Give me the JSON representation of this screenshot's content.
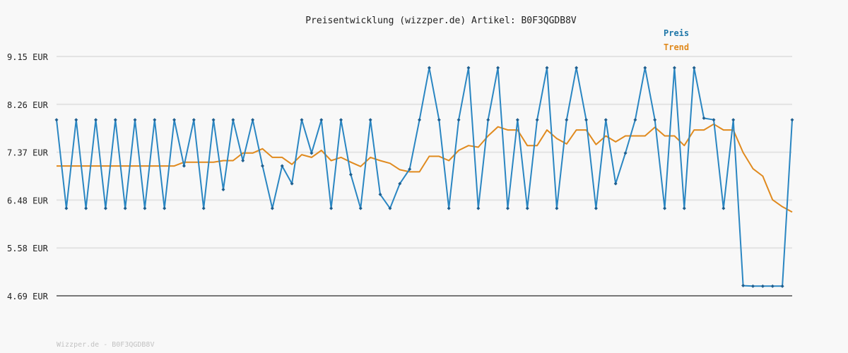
{
  "chart_data": {
    "type": "line",
    "title": "Preisentwicklung (wizzper.de) Artikel: B0F3QGDB8V",
    "footer": "Wizzper.de - B0F3QGDB8V",
    "yticks": [
      "9.15 EUR",
      "8.26 EUR",
      "7.37 EUR",
      "6.48 EUR",
      "5.58 EUR",
      "4.69 EUR"
    ],
    "ylim": [
      4.69,
      9.15
    ],
    "grid": true,
    "legend_position": "top-right",
    "series": [
      {
        "name": "Preis",
        "color": "#2a86c2",
        "markers": true,
        "values": [
          7.97,
          6.32,
          7.97,
          6.32,
          7.97,
          6.32,
          7.97,
          6.32,
          7.97,
          6.32,
          7.97,
          6.32,
          7.97,
          7.11,
          7.97,
          6.32,
          7.97,
          6.67,
          7.97,
          7.21,
          7.97,
          7.11,
          6.32,
          7.11,
          6.78,
          7.97,
          7.35,
          7.97,
          6.32,
          7.97,
          6.95,
          6.32,
          7.97,
          6.58,
          6.32,
          6.78,
          7.05,
          7.97,
          8.94,
          7.97,
          6.32,
          7.97,
          8.94,
          6.32,
          7.97,
          8.94,
          6.32,
          7.97,
          6.32,
          7.97,
          8.94,
          6.32,
          7.97,
          8.94,
          7.97,
          6.32,
          7.97,
          6.78,
          7.35,
          7.97,
          8.94,
          7.97,
          6.32,
          8.94,
          6.32,
          8.94,
          8.0,
          7.97,
          6.32,
          7.97,
          4.88,
          4.87,
          4.87,
          4.87,
          4.87,
          7.97
        ]
      },
      {
        "name": "Trend",
        "color": "#e08a1e",
        "markers": false,
        "values": [
          7.11,
          7.11,
          7.11,
          7.11,
          7.11,
          7.11,
          7.11,
          7.11,
          7.11,
          7.11,
          7.11,
          7.11,
          7.11,
          7.18,
          7.18,
          7.18,
          7.18,
          7.21,
          7.21,
          7.35,
          7.35,
          7.43,
          7.27,
          7.27,
          7.14,
          7.32,
          7.27,
          7.4,
          7.21,
          7.27,
          7.18,
          7.1,
          7.27,
          7.21,
          7.16,
          7.04,
          7.0,
          7.0,
          7.29,
          7.29,
          7.21,
          7.4,
          7.49,
          7.46,
          7.67,
          7.84,
          7.78,
          7.78,
          7.49,
          7.49,
          7.78,
          7.62,
          7.52,
          7.78,
          7.78,
          7.51,
          7.67,
          7.56,
          7.67,
          7.67,
          7.67,
          7.83,
          7.67,
          7.67,
          7.49,
          7.78,
          7.78,
          7.89,
          7.78,
          7.78,
          7.36,
          7.06,
          6.92,
          6.48,
          6.35,
          6.25
        ]
      }
    ]
  }
}
